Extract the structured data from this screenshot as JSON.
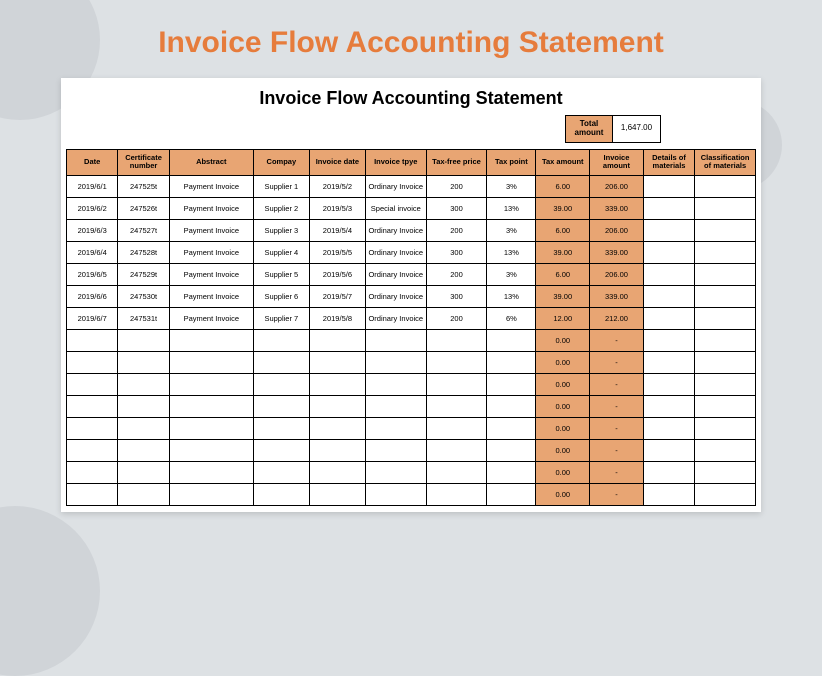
{
  "page_title": "Invoice Flow Accounting Statement",
  "sheet_title": "Invoice Flow Accounting Statement",
  "total": {
    "label1": "Total",
    "label2": "amount",
    "value": "1,647.00"
  },
  "headers": {
    "date": "Date",
    "cert": "Certificate number",
    "abs": "Abstract",
    "comp": "Compay",
    "idate": "Invoice date",
    "itype": "Invoice tpye",
    "tfree": "Tax-free price",
    "tpt": "Tax point",
    "tamt": "Tax amount",
    "iamt": "Invoice amount",
    "det": "Details of materials",
    "cls": "Classification of materials"
  },
  "rows": [
    {
      "date": "2019/6/1",
      "cert": "247525t",
      "abs": "Payment Invoice",
      "comp": "Supplier 1",
      "idate": "2019/5/2",
      "itype": "Ordinary Invoice",
      "tfree": "200",
      "tpt": "3%",
      "tamt": "6.00",
      "iamt": "206.00",
      "det": "",
      "cls": ""
    },
    {
      "date": "2019/6/2",
      "cert": "247526t",
      "abs": "Payment Invoice",
      "comp": "Supplier 2",
      "idate": "2019/5/3",
      "itype": "Special invoice",
      "tfree": "300",
      "tpt": "13%",
      "tamt": "39.00",
      "iamt": "339.00",
      "det": "",
      "cls": ""
    },
    {
      "date": "2019/6/3",
      "cert": "247527t",
      "abs": "Payment Invoice",
      "comp": "Supplier 3",
      "idate": "2019/5/4",
      "itype": "Ordinary Invoice",
      "tfree": "200",
      "tpt": "3%",
      "tamt": "6.00",
      "iamt": "206.00",
      "det": "",
      "cls": ""
    },
    {
      "date": "2019/6/4",
      "cert": "247528t",
      "abs": "Payment Invoice",
      "comp": "Supplier 4",
      "idate": "2019/5/5",
      "itype": "Ordinary Invoice",
      "tfree": "300",
      "tpt": "13%",
      "tamt": "39.00",
      "iamt": "339.00",
      "det": "",
      "cls": ""
    },
    {
      "date": "2019/6/5",
      "cert": "247529t",
      "abs": "Payment Invoice",
      "comp": "Supplier 5",
      "idate": "2019/5/6",
      "itype": "Ordinary Invoice",
      "tfree": "200",
      "tpt": "3%",
      "tamt": "6.00",
      "iamt": "206.00",
      "det": "",
      "cls": ""
    },
    {
      "date": "2019/6/6",
      "cert": "247530t",
      "abs": "Payment Invoice",
      "comp": "Supplier 6",
      "idate": "2019/5/7",
      "itype": "Ordinary Invoice",
      "tfree": "300",
      "tpt": "13%",
      "tamt": "39.00",
      "iamt": "339.00",
      "det": "",
      "cls": ""
    },
    {
      "date": "2019/6/7",
      "cert": "247531t",
      "abs": "Payment Invoice",
      "comp": "Supplier 7",
      "idate": "2019/5/8",
      "itype": "Ordinary Invoice",
      "tfree": "200",
      "tpt": "6%",
      "tamt": "12.00",
      "iamt": "212.00",
      "det": "",
      "cls": ""
    },
    {
      "date": "",
      "cert": "",
      "abs": "",
      "comp": "",
      "idate": "",
      "itype": "",
      "tfree": "",
      "tpt": "",
      "tamt": "0.00",
      "iamt": "-",
      "det": "",
      "cls": ""
    },
    {
      "date": "",
      "cert": "",
      "abs": "",
      "comp": "",
      "idate": "",
      "itype": "",
      "tfree": "",
      "tpt": "",
      "tamt": "0.00",
      "iamt": "-",
      "det": "",
      "cls": ""
    },
    {
      "date": "",
      "cert": "",
      "abs": "",
      "comp": "",
      "idate": "",
      "itype": "",
      "tfree": "",
      "tpt": "",
      "tamt": "0.00",
      "iamt": "-",
      "det": "",
      "cls": ""
    },
    {
      "date": "",
      "cert": "",
      "abs": "",
      "comp": "",
      "idate": "",
      "itype": "",
      "tfree": "",
      "tpt": "",
      "tamt": "0.00",
      "iamt": "-",
      "det": "",
      "cls": ""
    },
    {
      "date": "",
      "cert": "",
      "abs": "",
      "comp": "",
      "idate": "",
      "itype": "",
      "tfree": "",
      "tpt": "",
      "tamt": "0.00",
      "iamt": "-",
      "det": "",
      "cls": ""
    },
    {
      "date": "",
      "cert": "",
      "abs": "",
      "comp": "",
      "idate": "",
      "itype": "",
      "tfree": "",
      "tpt": "",
      "tamt": "0.00",
      "iamt": "-",
      "det": "",
      "cls": ""
    },
    {
      "date": "",
      "cert": "",
      "abs": "",
      "comp": "",
      "idate": "",
      "itype": "",
      "tfree": "",
      "tpt": "",
      "tamt": "0.00",
      "iamt": "-",
      "det": "",
      "cls": ""
    },
    {
      "date": "",
      "cert": "",
      "abs": "",
      "comp": "",
      "idate": "",
      "itype": "",
      "tfree": "",
      "tpt": "",
      "tamt": "0.00",
      "iamt": "-",
      "det": "",
      "cls": ""
    }
  ]
}
